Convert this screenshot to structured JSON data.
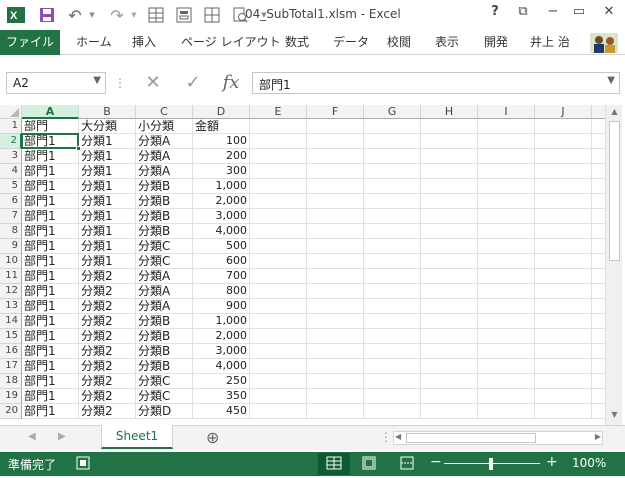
{
  "window": {
    "title": "04_SubTotal1.xlsm - Excel",
    "help_label": "?",
    "minimize_label": "−",
    "restore_label": "▭",
    "close_label": "✕",
    "ribbon_options_label": "⧉"
  },
  "ribbon": {
    "file_tab": "ファイル",
    "tabs": [
      "ホーム",
      "挿入",
      "ページ レイアウト",
      "数式",
      "データ",
      "校閲",
      "表示",
      "開発"
    ],
    "user": "井上 治"
  },
  "formula_bar": {
    "name_box": "A2",
    "cancel_icon": "✕",
    "enter_icon": "✓",
    "function_icon": "fx",
    "content": "部門1"
  },
  "sheet": {
    "columns": [
      "A",
      "B",
      "C",
      "D",
      "E",
      "F",
      "G",
      "H",
      "I",
      "J"
    ],
    "selected_column": "A",
    "selected_row": 2,
    "rows": [
      {
        "n": 1,
        "a": "部門",
        "b": "大分類",
        "c": "小分類",
        "d": "金額"
      },
      {
        "n": 2,
        "a": "部門1",
        "b": "分類1",
        "c": "分類A",
        "d": "100"
      },
      {
        "n": 3,
        "a": "部門1",
        "b": "分類1",
        "c": "分類A",
        "d": "200"
      },
      {
        "n": 4,
        "a": "部門1",
        "b": "分類1",
        "c": "分類A",
        "d": "300"
      },
      {
        "n": 5,
        "a": "部門1",
        "b": "分類1",
        "c": "分類B",
        "d": "1,000"
      },
      {
        "n": 6,
        "a": "部門1",
        "b": "分類1",
        "c": "分類B",
        "d": "2,000"
      },
      {
        "n": 7,
        "a": "部門1",
        "b": "分類1",
        "c": "分類B",
        "d": "3,000"
      },
      {
        "n": 8,
        "a": "部門1",
        "b": "分類1",
        "c": "分類B",
        "d": "4,000"
      },
      {
        "n": 9,
        "a": "部門1",
        "b": "分類1",
        "c": "分類C",
        "d": "500"
      },
      {
        "n": 10,
        "a": "部門1",
        "b": "分類1",
        "c": "分類C",
        "d": "600"
      },
      {
        "n": 11,
        "a": "部門1",
        "b": "分類2",
        "c": "分類A",
        "d": "700"
      },
      {
        "n": 12,
        "a": "部門1",
        "b": "分類2",
        "c": "分類A",
        "d": "800"
      },
      {
        "n": 13,
        "a": "部門1",
        "b": "分類2",
        "c": "分類A",
        "d": "900"
      },
      {
        "n": 14,
        "a": "部門1",
        "b": "分類2",
        "c": "分類B",
        "d": "1,000"
      },
      {
        "n": 15,
        "a": "部門1",
        "b": "分類2",
        "c": "分類B",
        "d": "2,000"
      },
      {
        "n": 16,
        "a": "部門1",
        "b": "分類2",
        "c": "分類B",
        "d": "3,000"
      },
      {
        "n": 17,
        "a": "部門1",
        "b": "分類2",
        "c": "分類B",
        "d": "4,000"
      },
      {
        "n": 18,
        "a": "部門1",
        "b": "分類2",
        "c": "分類C",
        "d": "250"
      },
      {
        "n": 19,
        "a": "部門1",
        "b": "分類2",
        "c": "分類C",
        "d": "350"
      },
      {
        "n": 20,
        "a": "部門1",
        "b": "分類2",
        "c": "分類D",
        "d": "450"
      }
    ]
  },
  "sheet_tabs": {
    "active": "Sheet1",
    "add_icon": "⊕"
  },
  "status": {
    "ready": "準備完了",
    "zoom": "100%",
    "zoom_minus": "−",
    "zoom_plus": "+"
  }
}
